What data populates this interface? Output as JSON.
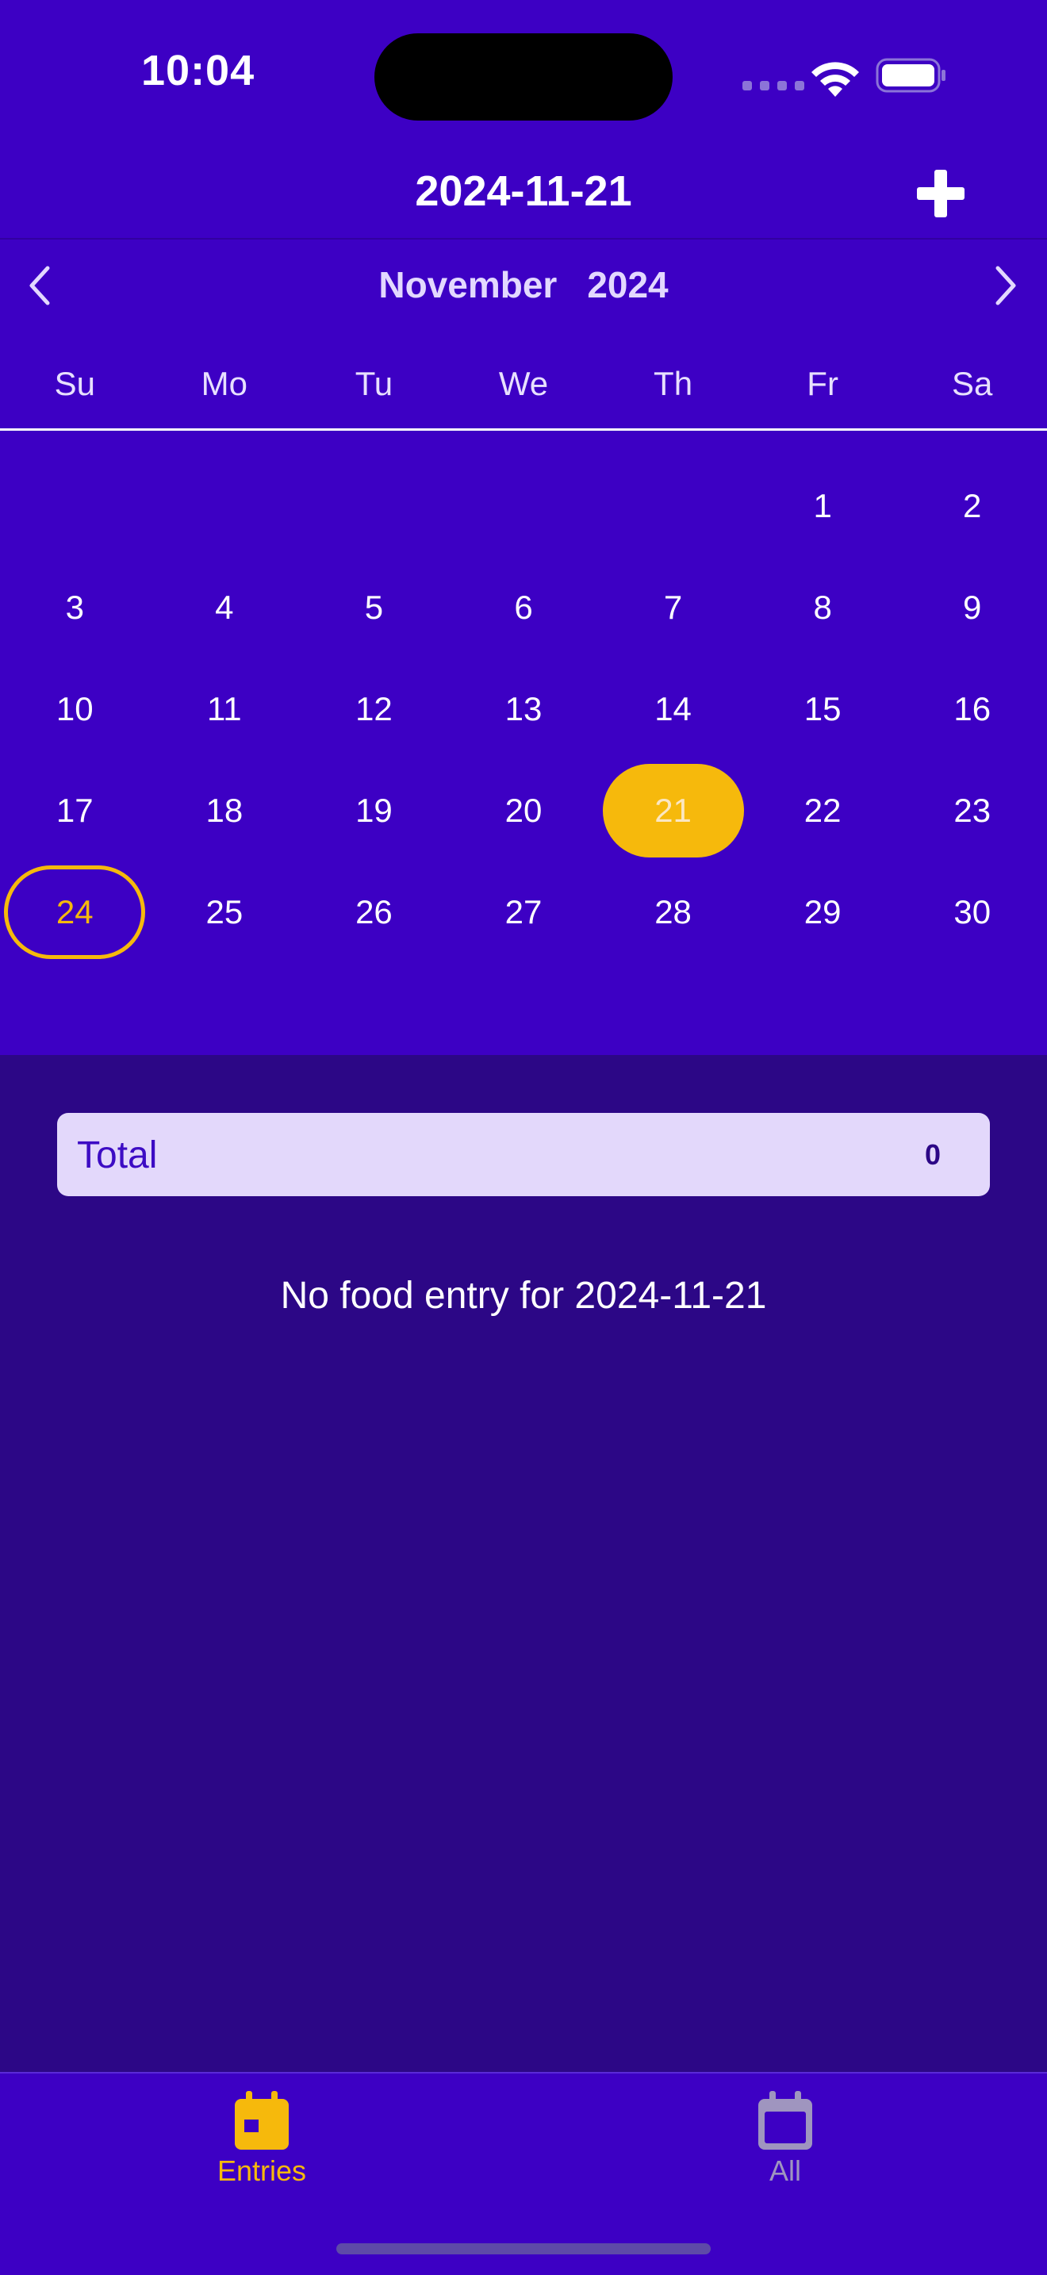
{
  "status_bar": {
    "time": "10:04"
  },
  "nav": {
    "title": "2024-11-21",
    "add_icon": "plus-icon"
  },
  "calendar": {
    "month": "November",
    "year": "2024",
    "prev_icon": "chevron-left-icon",
    "next_icon": "chevron-right-icon",
    "weekdays": [
      "Su",
      "Mo",
      "Tu",
      "We",
      "Th",
      "Fr",
      "Sa"
    ],
    "days": [
      "",
      "",
      "",
      "",
      "",
      "1",
      "2",
      "3",
      "4",
      "5",
      "6",
      "7",
      "8",
      "9",
      "10",
      "11",
      "12",
      "13",
      "14",
      "15",
      "16",
      "17",
      "18",
      "19",
      "20",
      "21",
      "22",
      "23",
      "24",
      "25",
      "26",
      "27",
      "28",
      "29",
      "30"
    ],
    "selected_day": "21",
    "today": "24"
  },
  "summary": {
    "total_label": "Total",
    "total_value": "0"
  },
  "empty_message": "No food entry for 2024-11-21",
  "tabbar": {
    "tabs": [
      {
        "label": "Entries",
        "icon": "calendar-icon",
        "active": true
      },
      {
        "label": "All",
        "icon": "calendar-icon",
        "active": false
      }
    ]
  },
  "colors": {
    "header_bg": "#3d00c4",
    "body_bg": "#2c0786",
    "accent": "#f6b90c",
    "total_bar_bg": "#e3d8fb"
  }
}
